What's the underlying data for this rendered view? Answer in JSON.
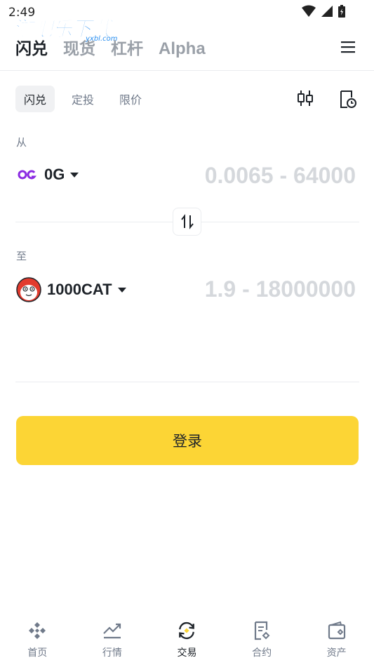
{
  "status_bar": {
    "time": "2:49"
  },
  "watermark": {
    "text": "游吧乐下载",
    "sub": "yxbl.com"
  },
  "top_tabs": [
    {
      "label": "闪兑",
      "active": true
    },
    {
      "label": "现货",
      "active": false
    },
    {
      "label": "杠杆",
      "active": false
    },
    {
      "label": "Alpha",
      "active": false
    }
  ],
  "sub_tabs": [
    {
      "label": "闪兑",
      "active": true
    },
    {
      "label": "定投",
      "active": false
    },
    {
      "label": "限价",
      "active": false
    }
  ],
  "from": {
    "label": "从",
    "coin": "0G",
    "coin_icon": "0g-logo-icon",
    "placeholder": "0.0065 - 64000"
  },
  "to": {
    "label": "至",
    "coin": "1000CAT",
    "coin_icon": "cat-avatar-icon",
    "placeholder": "1.9 - 18000000"
  },
  "login_button": {
    "label": "登录"
  },
  "bottom_nav": [
    {
      "label": "首页",
      "icon": "home-diamond-icon",
      "active": false
    },
    {
      "label": "行情",
      "icon": "market-chart-icon",
      "active": false
    },
    {
      "label": "交易",
      "icon": "trade-swap-icon",
      "active": true
    },
    {
      "label": "合约",
      "icon": "futures-document-icon",
      "active": false
    },
    {
      "label": "资产",
      "icon": "wallet-icon",
      "active": false
    }
  ],
  "colors": {
    "accent": "#fcd535",
    "text_primary": "#1e2329",
    "text_secondary": "#707a8a",
    "placeholder": "#d5d8dc",
    "coin_purple": "#8b2be2",
    "divider": "#eaecef"
  }
}
